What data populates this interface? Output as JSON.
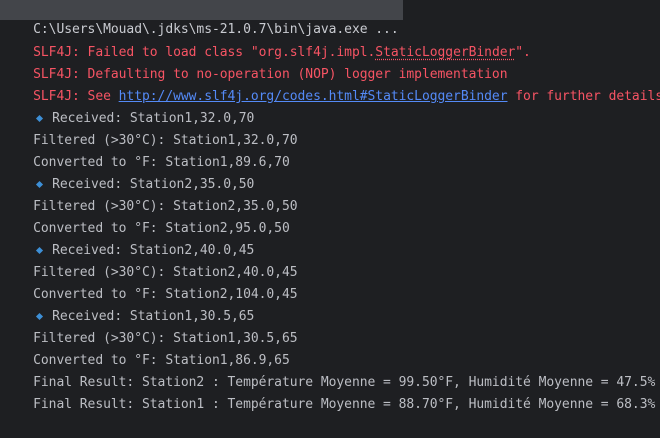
{
  "command": {
    "text": "C:\\Users\\Mouad\\.jdks\\ms-21.0.7\\bin\\java.exe ..."
  },
  "slf4j": {
    "prefix": "SLF4J: ",
    "failed_pre": "Failed to load class \"org.slf4j.impl.",
    "failed_class": "StaticLoggerBinder",
    "failed_post": "\".",
    "defaulting": "Defaulting to no-operation (NOP) logger implementation",
    "see_pre": "See ",
    "url": "http://www.slf4j.org/codes.html#StaticLoggerBinder",
    "see_post": " for further details."
  },
  "output": [
    {
      "kind": "received",
      "text": "Received: Station1,32.0,70"
    },
    {
      "kind": "plain",
      "text": "Filtered (>30°C): Station1,32.0,70"
    },
    {
      "kind": "plain",
      "text": "Converted to °F: Station1,89.6,70"
    },
    {
      "kind": "received",
      "text": "Received: Station2,35.0,50"
    },
    {
      "kind": "plain",
      "text": "Filtered (>30°C): Station2,35.0,50"
    },
    {
      "kind": "plain",
      "text": "Converted to °F: Station2,95.0,50"
    },
    {
      "kind": "received",
      "text": "Received: Station2,40.0,45"
    },
    {
      "kind": "plain",
      "text": "Filtered (>30°C): Station2,40.0,45"
    },
    {
      "kind": "plain",
      "text": "Converted to °F: Station2,104.0,45"
    },
    {
      "kind": "received",
      "text": "Received: Station1,30.5,65"
    },
    {
      "kind": "plain",
      "text": "Filtered (>30°C): Station1,30.5,65"
    },
    {
      "kind": "plain",
      "text": "Converted to °F: Station1,86.9,65"
    },
    {
      "kind": "plain",
      "text": "Final Result: Station2 : Température Moyenne = 99.50°F, Humidité Moyenne = 47.5%"
    },
    {
      "kind": "plain",
      "text": "Final Result: Station1 : Température Moyenne = 88.70°F, Humidité Moyenne = 68.3%"
    }
  ],
  "colors": {
    "background": "#1e1f22",
    "text": "#bcbec4",
    "error": "#f75464",
    "link": "#548af7",
    "marker": "#3d8fd6"
  },
  "icons": {
    "received_marker": "blue-diamond-icon"
  }
}
